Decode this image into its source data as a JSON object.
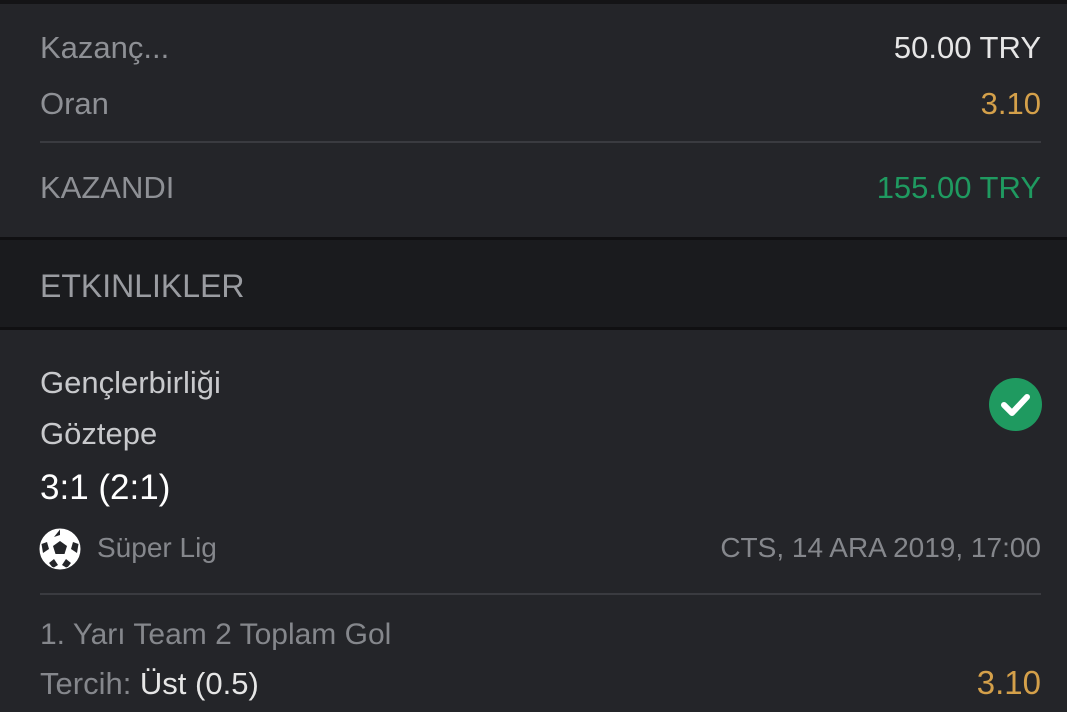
{
  "summary": {
    "win_label": "Kazanç...",
    "win_value": "50.00 TRY",
    "odds_label": "Oran",
    "odds_value": "3.10",
    "status_label": "KAZANDI",
    "status_value": "155.00 TRY"
  },
  "section": {
    "title": "ETKINLIKLER"
  },
  "event": {
    "team_home": "Gençlerbirliği",
    "team_away": "Göztepe",
    "score": "3:1 (2:1)",
    "league": "Süper Lig",
    "datetime": "CTS, 14 ARA 2019, 17:00",
    "status_icon": "check-circle-icon",
    "sport_icon": "soccer-ball-icon",
    "market": "1. Yarı Team 2 Toplam Gol",
    "pick_label": "Tercih: ",
    "pick_value": "Üst (0.5)",
    "pick_odds": "3.10"
  },
  "colors": {
    "background": "#242529",
    "header_background": "#1a1b1e",
    "odds": "#d4a04a",
    "won": "#1f9a60"
  }
}
